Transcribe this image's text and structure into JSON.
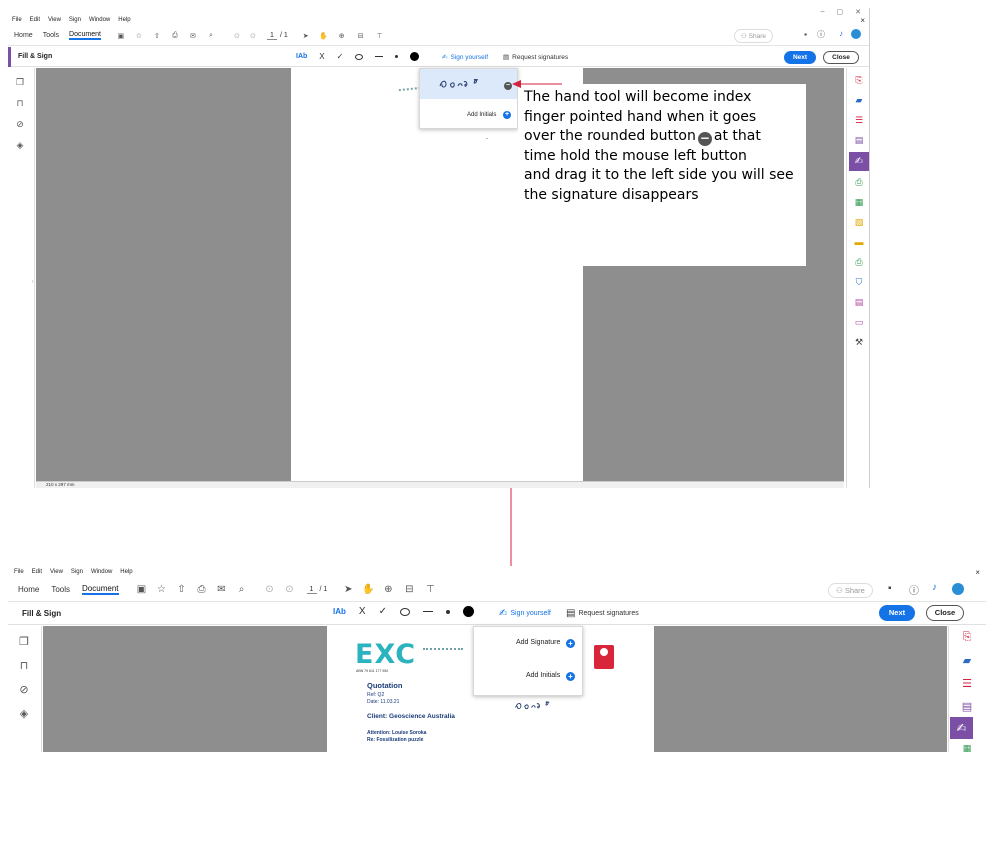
{
  "top": {
    "menu": [
      "File",
      "Edit",
      "View",
      "Sign",
      "Window",
      "Help"
    ],
    "window_controls": [
      "–",
      "▢",
      "✕"
    ],
    "nav_tabs": [
      "Home",
      "Tools",
      "Document"
    ],
    "page_current": "1",
    "page_total": "/ 1",
    "share_label": "Share",
    "fill_sign_title": "Fill & Sign",
    "tools": {
      "text_tool": "IAb",
      "cross": "X",
      "check": "✓"
    },
    "sign_yourself": "Sign yourself",
    "request_signatures": "Request signatures",
    "next_label": "Next",
    "close_label": "Close",
    "dropdown": {
      "add_initials": "Add Initials"
    },
    "status_size": "210 x 297 mm",
    "annotation": "The hand tool will become index finger pointed hand when it goes over the rounded button ● at that time hold the mouse left button and drag it to the left side you will see the signature disappears",
    "annotation_lines": [
      "The hand tool will become index",
      "finger pointed hand when it goes",
      "over the rounded button",
      "at that",
      "time hold the mouse left button",
      "and drag it to the left side you will see",
      "the signature disappears"
    ]
  },
  "bottom": {
    "menu": [
      "File",
      "Edit",
      "View",
      "Sign",
      "Window",
      "Help"
    ],
    "nav_tabs": [
      "Home",
      "Tools",
      "Document"
    ],
    "page_current": "1",
    "page_total": "/ 1",
    "share_label": "Share",
    "fill_sign_title": "Fill & Sign",
    "tools": {
      "text_tool": "IAb",
      "cross": "X",
      "check": "✓"
    },
    "sign_yourself": "Sign yourself",
    "request_signatures": "Request signatures",
    "next_label": "Next",
    "close_label": "Close",
    "dropdown": {
      "add_signature": "Add Signature",
      "add_initials": "Add Initials"
    },
    "doc": {
      "logo": "EXC",
      "abn": "ABN 79 611 177 952",
      "heading": "Quotation",
      "ref": "Ref: Q2",
      "date": "Date: 11.03.21",
      "client": "Client: Geoscience Australia",
      "attention": "Attention: Louise Soroka",
      "re": "Re: Fossilization puzzle"
    }
  },
  "colors": {
    "accent": "#1473e6",
    "fill_sign_purple": "#7b4fa6",
    "gray_canvas": "#8e8e8e",
    "arrow_red": "#d4213d"
  },
  "icons": [
    "bookmark-icon",
    "attachment-icon",
    "layers-icon",
    "pages-icon",
    "hand-icon",
    "zoom-icon",
    "print-icon",
    "star-icon",
    "upload-icon",
    "mail-icon",
    "search-icon",
    "help-icon",
    "bell-icon",
    "chat-icon"
  ]
}
